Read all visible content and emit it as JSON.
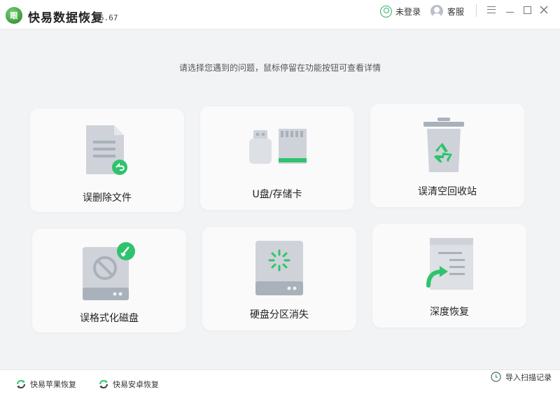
{
  "app": {
    "logo_text": "眼",
    "title": "快易数据恢复",
    "version": "5.67"
  },
  "titlebar": {
    "login_label": "未登录",
    "service_label": "客服"
  },
  "main": {
    "subtitle": "请选择您遇到的问题，鼠标停留在功能按钮可查看详情",
    "cards": [
      {
        "label": "误删除文件",
        "icon": "deleted-file-icon"
      },
      {
        "label": "U盘/存储卡",
        "icon": "usb-sdcard-icon"
      },
      {
        "label": "误清空回收站",
        "icon": "recycle-bin-icon"
      },
      {
        "label": "误格式化磁盘",
        "icon": "formatted-disk-icon"
      },
      {
        "label": "硬盘分区消失",
        "icon": "missing-partition-icon"
      },
      {
        "label": "深度恢复",
        "icon": "deep-recovery-icon"
      }
    ]
  },
  "bottom": {
    "apple_label": "快易苹果恢复",
    "android_label": "快易安卓恢复",
    "import_label": "导入扫描记录"
  },
  "colors": {
    "accent_green": "#2fc36d",
    "icon_gray": "#cfd3d9",
    "icon_dark_gray": "#a9b1bb",
    "background": "#f2f3f5"
  }
}
